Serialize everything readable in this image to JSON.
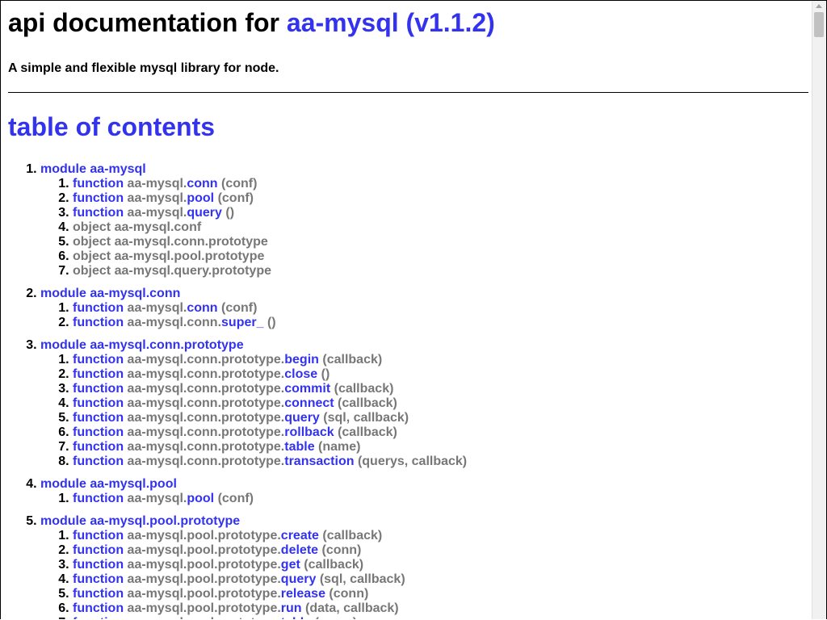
{
  "header": {
    "title_prefix": "api documentation for ",
    "title_pkg": "aa-mysql (v1.1.2)",
    "description": "A simple and flexible mysql library for node."
  },
  "toc": {
    "title": "table of contents",
    "modules": [
      {
        "label": "module aa-mysql",
        "items": [
          {
            "kind": "function",
            "path": "aa-mysql.",
            "name": "conn",
            "args": "(conf)"
          },
          {
            "kind": "function",
            "path": "aa-mysql.",
            "name": "pool",
            "args": "(conf)"
          },
          {
            "kind": "function",
            "path": "aa-mysql.",
            "name": "query",
            "args": "()"
          },
          {
            "kind": "object",
            "path": "aa-mysql.conf"
          },
          {
            "kind": "object",
            "path": "aa-mysql.conn.prototype"
          },
          {
            "kind": "object",
            "path": "aa-mysql.pool.prototype"
          },
          {
            "kind": "object",
            "path": "aa-mysql.query.prototype"
          }
        ]
      },
      {
        "label": "module aa-mysql.conn",
        "items": [
          {
            "kind": "function",
            "path": "aa-mysql.",
            "name": "conn",
            "args": "(conf)"
          },
          {
            "kind": "function",
            "path": "aa-mysql.conn.",
            "name": "super_",
            "args": "()"
          }
        ]
      },
      {
        "label": "module aa-mysql.conn.prototype",
        "items": [
          {
            "kind": "function",
            "path": "aa-mysql.conn.prototype.",
            "name": "begin",
            "args": "(callback)"
          },
          {
            "kind": "function",
            "path": "aa-mysql.conn.prototype.",
            "name": "close",
            "args": "()"
          },
          {
            "kind": "function",
            "path": "aa-mysql.conn.prototype.",
            "name": "commit",
            "args": "(callback)"
          },
          {
            "kind": "function",
            "path": "aa-mysql.conn.prototype.",
            "name": "connect",
            "args": "(callback)"
          },
          {
            "kind": "function",
            "path": "aa-mysql.conn.prototype.",
            "name": "query",
            "args": "(sql, callback)"
          },
          {
            "kind": "function",
            "path": "aa-mysql.conn.prototype.",
            "name": "rollback",
            "args": "(callback)"
          },
          {
            "kind": "function",
            "path": "aa-mysql.conn.prototype.",
            "name": "table",
            "args": "(name)"
          },
          {
            "kind": "function",
            "path": "aa-mysql.conn.prototype.",
            "name": "transaction",
            "args": "(querys, callback)"
          }
        ]
      },
      {
        "label": "module aa-mysql.pool",
        "items": [
          {
            "kind": "function",
            "path": "aa-mysql.",
            "name": "pool",
            "args": "(conf)"
          }
        ]
      },
      {
        "label": "module aa-mysql.pool.prototype",
        "items": [
          {
            "kind": "function",
            "path": "aa-mysql.pool.prototype.",
            "name": "create",
            "args": "(callback)"
          },
          {
            "kind": "function",
            "path": "aa-mysql.pool.prototype.",
            "name": "delete",
            "args": "(conn)"
          },
          {
            "kind": "function",
            "path": "aa-mysql.pool.prototype.",
            "name": "get",
            "args": "(callback)"
          },
          {
            "kind": "function",
            "path": "aa-mysql.pool.prototype.",
            "name": "query",
            "args": "(sql, callback)"
          },
          {
            "kind": "function",
            "path": "aa-mysql.pool.prototype.",
            "name": "release",
            "args": "(conn)"
          },
          {
            "kind": "function",
            "path": "aa-mysql.pool.prototype.",
            "name": "run",
            "args": "(data, callback)"
          },
          {
            "kind": "function",
            "path": "aa-mysql.pool.prototype.",
            "name": "table",
            "args": "(name)"
          }
        ]
      }
    ]
  },
  "colors": {
    "link": "#3333ee",
    "muted": "#777777"
  }
}
